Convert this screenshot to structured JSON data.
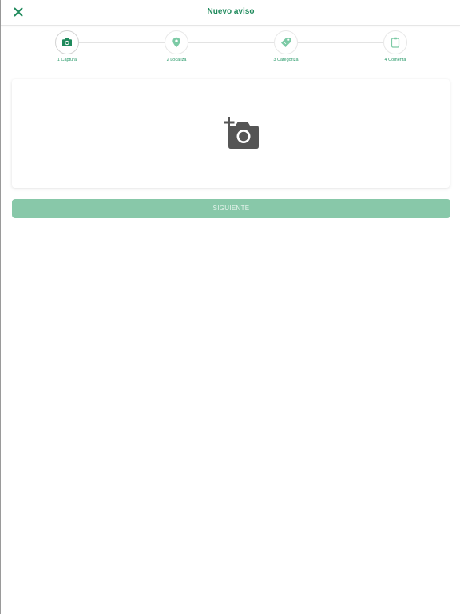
{
  "header": {
    "title": "Nuevo aviso",
    "close_icon": "close-icon"
  },
  "stepper": {
    "steps": [
      {
        "label": "1 Captura",
        "icon": "camera-icon",
        "active": true
      },
      {
        "label": "2 Localiza",
        "icon": "location-pin-icon",
        "active": false
      },
      {
        "label": "3 Categoriza",
        "icon": "tag-icon",
        "active": false
      },
      {
        "label": "4 Comenta",
        "icon": "clipboard-icon",
        "active": false
      }
    ]
  },
  "photo_card": {
    "icon": "add-photo-icon"
  },
  "footer": {
    "next_label": "SIGUIENTE"
  },
  "colors": {
    "accent": "#1f8a5c",
    "step_icon_active": "#1f8a5c",
    "step_icon_inactive": "#7ccaa5",
    "button_bg": "#88c8a9",
    "button_text": "#e8f5ee",
    "photo_icon": "#555555"
  }
}
